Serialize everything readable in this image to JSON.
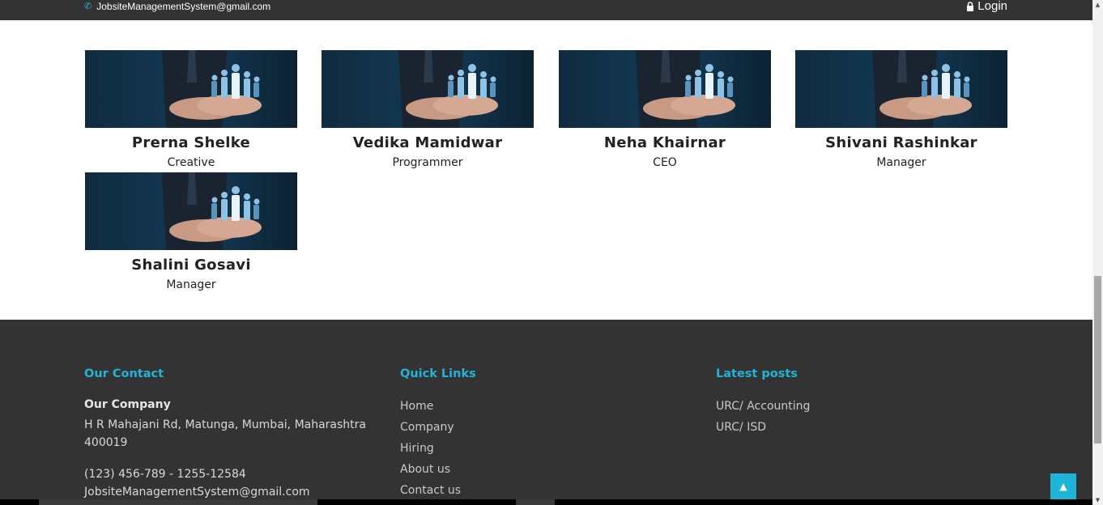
{
  "topbar": {
    "email": "JobsiteManagementSystem@gmail.com",
    "login_label": "Login"
  },
  "team": [
    {
      "name": "Prerna Shelke",
      "role": "Creative"
    },
    {
      "name": "Vedika Mamidwar",
      "role": "Programmer"
    },
    {
      "name": "Neha Khairnar",
      "role": "CEO"
    },
    {
      "name": "Shivani Rashinkar",
      "role": "Manager"
    },
    {
      "name": "Shalini Gosavi",
      "role": "Manager"
    }
  ],
  "footer": {
    "contact": {
      "heading": "Our Contact",
      "company": "Our Company",
      "address": "H R Mahajani Rd, Matunga, Mumbai, Maharashtra 400019",
      "phone": "(123) 456-789 - 1255-12584",
      "email": "JobsiteManagementSystem@gmail.com"
    },
    "quick_links": {
      "heading": "Quick Links",
      "items": [
        "Home",
        "Company",
        "Hiring",
        "About us",
        "Contact us"
      ]
    },
    "latest_posts": {
      "heading": "Latest posts",
      "items": [
        "URC/ Accounting",
        "URC/ ISD"
      ]
    }
  },
  "colors": {
    "accent": "#22b3d6",
    "dark_bg": "#333333"
  }
}
